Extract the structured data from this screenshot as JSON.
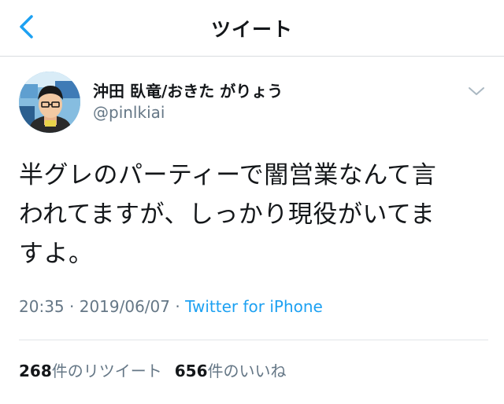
{
  "nav": {
    "title": "ツイート",
    "back_icon": "chevron-left-icon"
  },
  "tweet": {
    "author_name": "沖田 臥竜/おきた がりょう",
    "author_handle": "@pinlkiai",
    "text_lines": [
      "半グレのパーティーで闇営業なんて言",
      "われてますが、しっかり現役がいてま",
      "すよ。"
    ],
    "time": "20:35",
    "sep1": " · ",
    "date": "2019/06/07",
    "sep2": " · ",
    "source": "Twitter for iPhone",
    "menu_icon": "chevron-down-icon"
  },
  "stats": {
    "retweets_count": "268",
    "retweets_label": "件のリツイート",
    "likes_count": "656",
    "likes_label": "件のいいね"
  },
  "colors": {
    "accent": "#1da1f2",
    "secondary_text": "#657786",
    "primary_text": "#14171a"
  }
}
